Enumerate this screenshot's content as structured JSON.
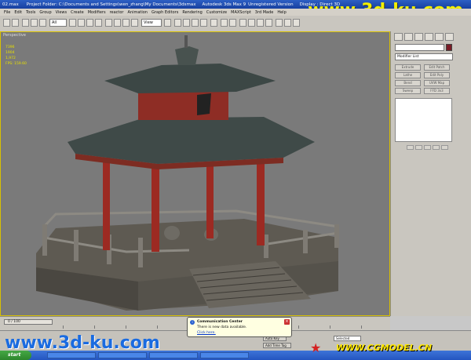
{
  "titlebar": {
    "file": "02.max",
    "project": "Project Folder: C:\\Documents and Settings\\wen_zhang\\My Documents\\3dsmax",
    "app": "Autodesk 3ds Max 9",
    "version": "Unregistered Version",
    "display": "Display : Direct 3D"
  },
  "watermark_top": "www.3d-ku.com",
  "watermark_bottom": "www.3d-ku.com",
  "watermark_cg": "WWW.CGMODEL.CN",
  "menu": [
    "File",
    "Edit",
    "Tools",
    "Group",
    "Views",
    "Create",
    "Modifiers",
    "reactor",
    "Animation",
    "Graph Editors",
    "Rendering",
    "Customize",
    "MAXScript",
    "3rd Made",
    "Help"
  ],
  "toolbar": {
    "selection_filter": "All",
    "coord_system": "View"
  },
  "viewport": {
    "label": "Perspective",
    "stats": [
      "7396",
      "1904",
      "1,972",
      "FPS: 159.60"
    ]
  },
  "command_panel": {
    "modifier_list": "Modifier List",
    "buttons": [
      "Extrude",
      "Edit Patch",
      "Lathe",
      "Edit Poly",
      "Bend",
      "UVW Map",
      "Sweep",
      "FFD 3x3",
      "Shell",
      "Edit Spline"
    ]
  },
  "timeline": {
    "frame_counter": "0 / 100"
  },
  "balloon": {
    "title": "Communication Center",
    "line": "There is new data available.",
    "link": "Click here."
  },
  "status": {
    "set_key": "Selected",
    "add_time_tag": "Add Time Tag",
    "auto_key": "Auto Key"
  },
  "taskbar": {
    "start": "start"
  }
}
